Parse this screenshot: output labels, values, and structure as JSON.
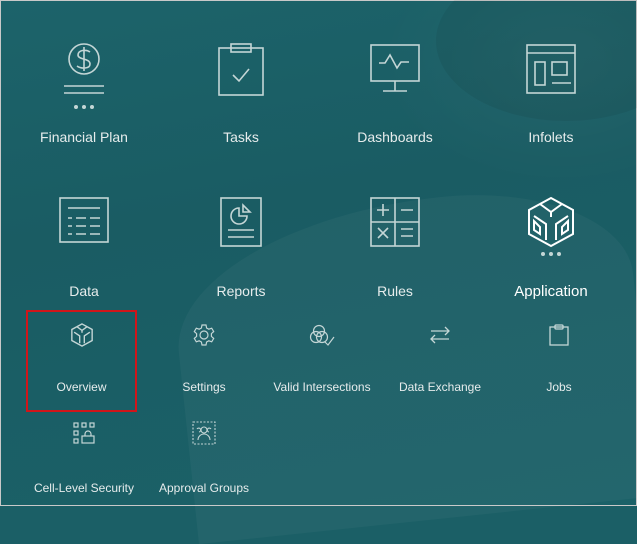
{
  "colors": {
    "background": "#1b5f66",
    "icon_stroke": "#c4d6d6",
    "label_text": "#e6ecec",
    "selection_border": "#d0151a"
  },
  "main_tiles": [
    {
      "label": "Financial Plan",
      "icon": "dollar-document-icon",
      "has_more": true
    },
    {
      "label": "Tasks",
      "icon": "clipboard-check-icon",
      "has_more": false
    },
    {
      "label": "Dashboards",
      "icon": "monitor-pulse-icon",
      "has_more": false
    },
    {
      "label": "Infolets",
      "icon": "layout-panel-icon",
      "has_more": false
    },
    {
      "label": "Data",
      "icon": "table-list-icon",
      "has_more": false
    },
    {
      "label": "Reports",
      "icon": "report-pie-icon",
      "has_more": false
    },
    {
      "label": "Rules",
      "icon": "calculator-icon",
      "has_more": false
    },
    {
      "label": "Application",
      "icon": "cube-icon",
      "has_more": true,
      "active": true
    }
  ],
  "sub_tiles": [
    {
      "label": "Overview",
      "icon": "cube-icon",
      "selected": true
    },
    {
      "label": "Settings",
      "icon": "gear-icon"
    },
    {
      "label": "Valid Intersections",
      "icon": "venn-check-icon"
    },
    {
      "label": "Data Exchange",
      "icon": "swap-arrows-icon"
    },
    {
      "label": "Jobs",
      "icon": "clipboard-icon"
    },
    {
      "label": "Cell-Level Security",
      "icon": "grid-lock-icon"
    },
    {
      "label": "Approval Groups",
      "icon": "group-users-icon"
    }
  ]
}
